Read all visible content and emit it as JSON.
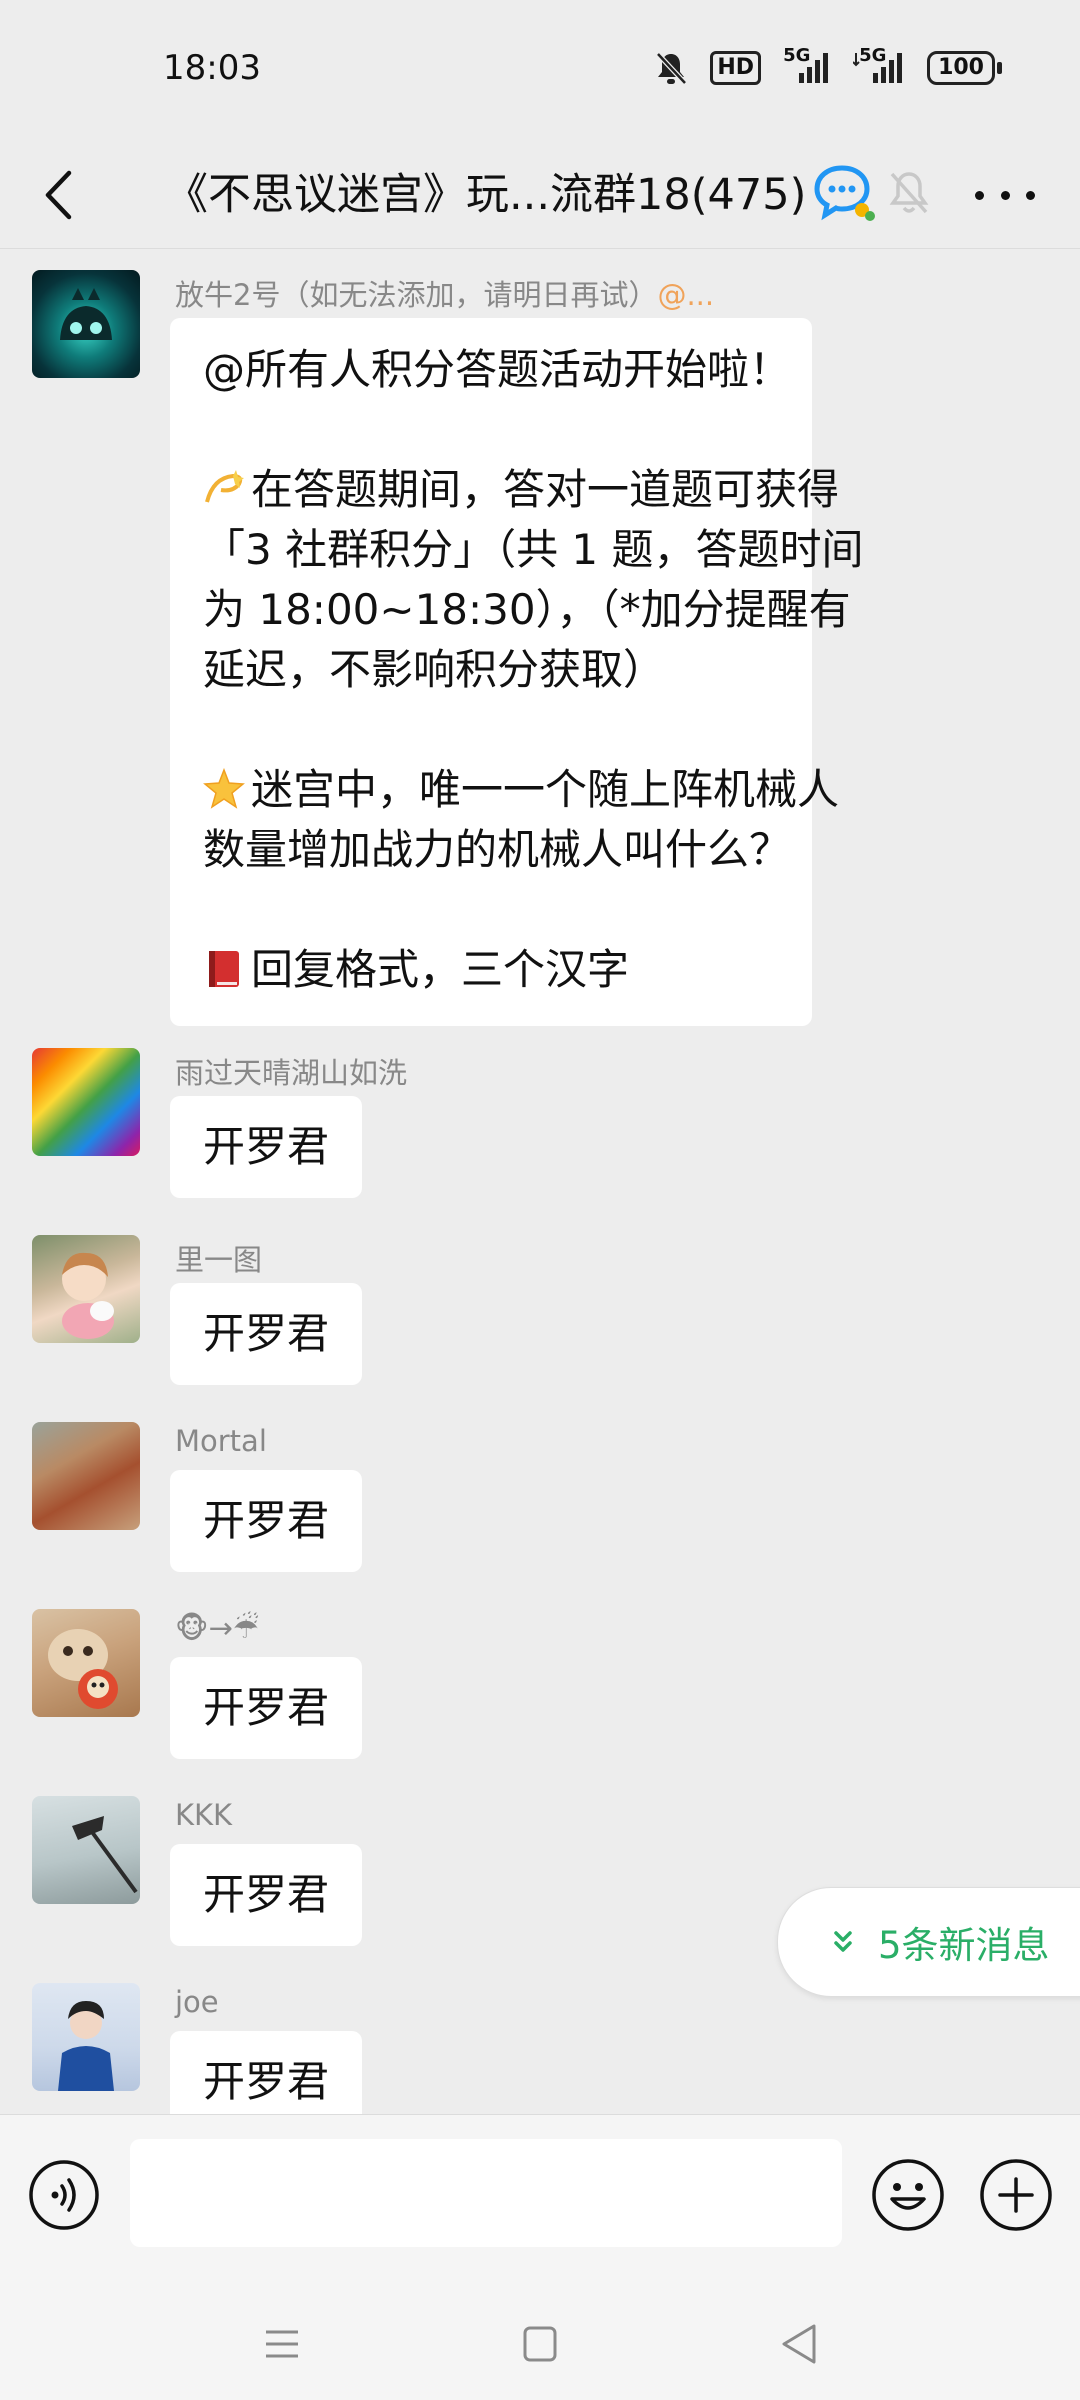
{
  "status_bar": {
    "time": "18:03",
    "hd_label": "HD",
    "net_left": "5G",
    "net_right": "5G",
    "battery": "100"
  },
  "header": {
    "title": "《不思议迷宫》玩...流群18(475)",
    "back_icon": "chevron-left-icon",
    "group_icon": "group-chat-icon",
    "mute_icon": "muted-bell-icon",
    "more_icon": "more-dots-icon"
  },
  "messages": [
    {
      "sender": "放牛2号（如无法添加，请明日再试）",
      "sender_suffix": "@...",
      "lines": [
        "@所有人积分答题活动开始啦！",
        "",
        "在答题期间，答对一道题可获得",
        "「3 社群积分」（共 1 题，答题时间",
        "为 18:00~18:30），（*加分提醒有",
        "延迟，不影响积分获取）",
        "",
        "迷宫中，唯一一个随上阵机械人",
        "数量增加战力的机械人叫什么？",
        "",
        "回复格式，三个汉字"
      ]
    },
    {
      "sender": "雨过天晴湖山如洗",
      "text": "开罗君"
    },
    {
      "sender": "里一图",
      "text": "开罗君"
    },
    {
      "sender": "Mortal",
      "text": "开罗君"
    },
    {
      "sender": "🐵→☔",
      "text": "开罗君"
    },
    {
      "sender": "KKK",
      "text": "开罗君"
    },
    {
      "sender": "joe",
      "text": "开罗君"
    }
  ],
  "new_messages": {
    "label": "5条新消息"
  },
  "input_bar": {
    "placeholder": ""
  },
  "colors": {
    "background": "#ededed",
    "bubble": "#ffffff",
    "accent_green": "#2aae67",
    "mention_orange": "#f0a35a"
  }
}
